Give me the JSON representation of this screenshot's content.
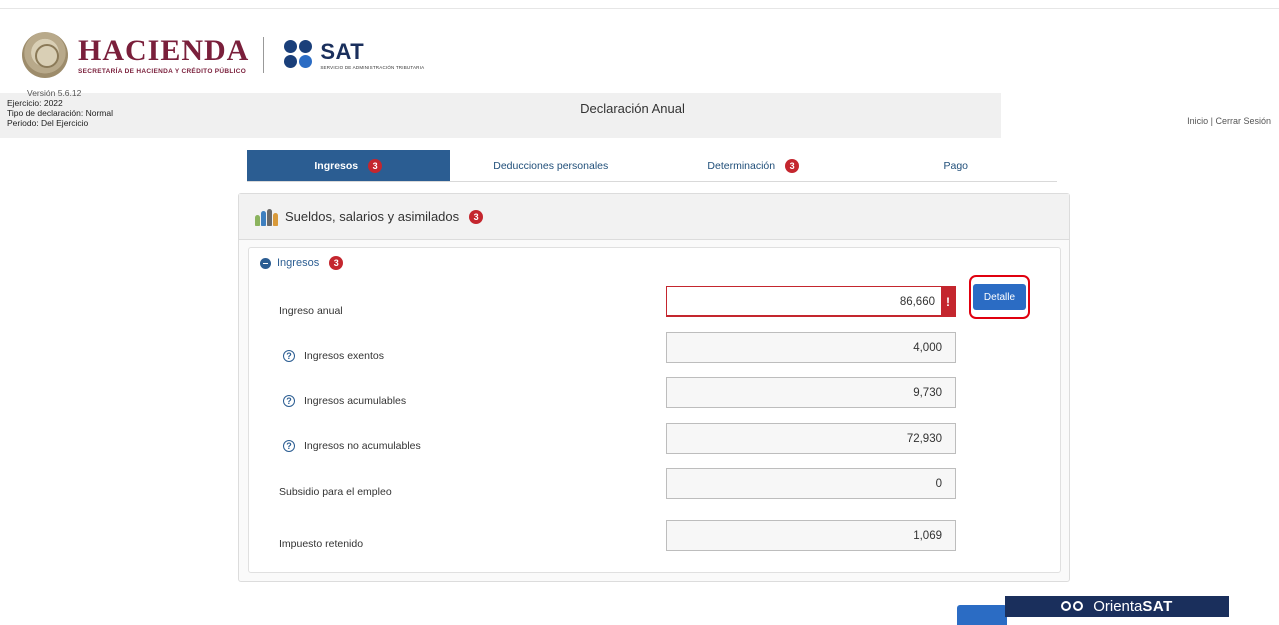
{
  "header": {
    "hacienda_name": "HACIENDA",
    "hacienda_subtitle": "SECRETARÍA DE HACIENDA Y CRÉDITO PÚBLICO",
    "sat_name": "SAT",
    "sat_subtitle": "SERVICIO DE ADMINISTRACIÓN TRIBUTARIA"
  },
  "info": {
    "version": "Versión 5.6.12",
    "ejercicio": "Ejercicio: 2022",
    "tipo": "Tipo de declaración: Normal",
    "periodo": "Periodo: Del Ejercicio",
    "title": "Declaración Anual",
    "links": "Inicio | Cerrar Sesión"
  },
  "tabs": [
    {
      "label": "Ingresos",
      "badge": "3",
      "active": true
    },
    {
      "label": "Deducciones personales",
      "badge": "",
      "active": false
    },
    {
      "label": "Determinación",
      "badge": "3",
      "active": false
    },
    {
      "label": "Pago",
      "badge": "",
      "active": false
    }
  ],
  "panel": {
    "title": "Sueldos, salarios y asimilados",
    "badge": "3",
    "section_title": "Ingresos",
    "section_badge": "3",
    "detalle_label": "Detalle",
    "error_mark": "!",
    "rows": [
      {
        "label": "Ingreso anual",
        "value": "86,660"
      },
      {
        "label": "Ingresos exentos",
        "value": "4,000"
      },
      {
        "label": "Ingresos acumulables",
        "value": "9,730"
      },
      {
        "label": "Ingresos no acumulables",
        "value": "72,930"
      },
      {
        "label": "Subsidio para el empleo",
        "value": "0"
      },
      {
        "label": "Impuesto retenido",
        "value": "1,069"
      }
    ]
  },
  "orienta": {
    "prefix": "Orienta",
    "brand": "SAT"
  },
  "icons": {
    "help": "?",
    "people": "people-icon",
    "owl": "owl-icon"
  },
  "colors": {
    "primary": "#2b5d92",
    "badge": "#c4262e",
    "highlight": "#e0000f",
    "orienta_bg": "#1a2f5c",
    "hacienda": "#7a1f3b"
  }
}
